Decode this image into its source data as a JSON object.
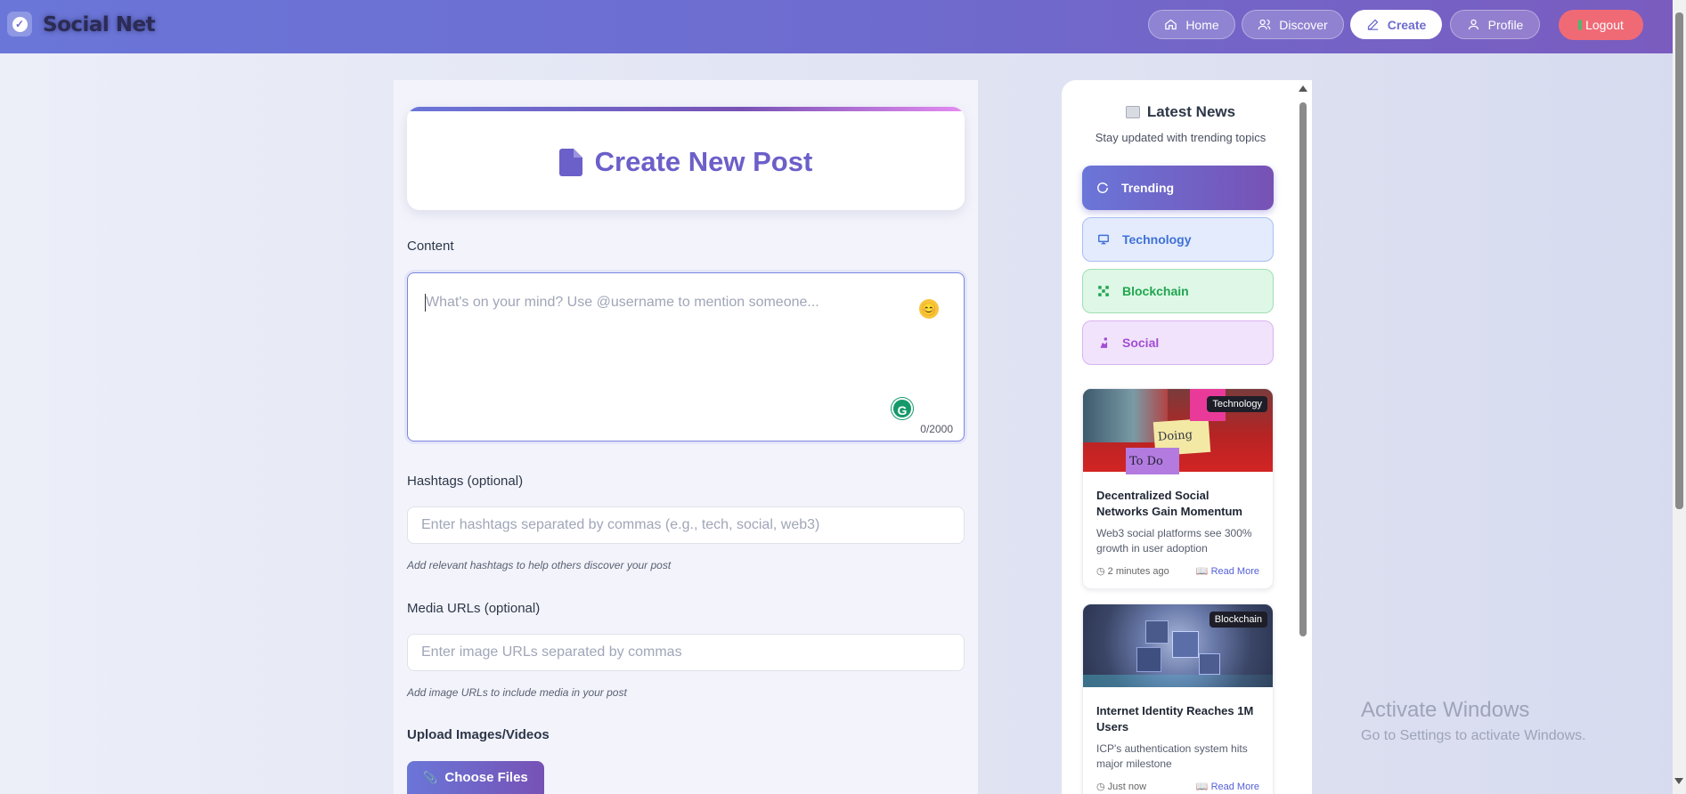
{
  "app": {
    "brand": "Social Net"
  },
  "nav": {
    "home": "Home",
    "discover": "Discover",
    "create": "Create",
    "profile": "Profile",
    "logout": "Logout"
  },
  "form": {
    "title": "Create New Post",
    "content_label": "Content",
    "content_placeholder": "What's on your mind? Use @username to mention someone...",
    "content_value": "",
    "char_counter": "0/2000",
    "hashtags_label": "Hashtags (optional)",
    "hashtags_placeholder": "Enter hashtags separated by commas (e.g., tech, social, web3)",
    "hashtags_hint": "Add relevant hashtags to help others discover your post",
    "media_label": "Media URLs (optional)",
    "media_placeholder": "Enter image URLs separated by commas",
    "media_hint": "Add image URLs to include media in your post",
    "upload_label": "Upload Images/Videos",
    "choose_files": "Choose Files"
  },
  "news": {
    "title": "Latest News",
    "subtitle": "Stay updated with trending topics",
    "categories": [
      {
        "label": "Trending",
        "icon": "refresh-icon"
      },
      {
        "label": "Technology",
        "icon": "monitor-icon"
      },
      {
        "label": "Blockchain",
        "icon": "blocks-icon"
      },
      {
        "label": "Social",
        "icon": "people-icon"
      }
    ],
    "articles": [
      {
        "tag": "Technology",
        "headline": "Decentralized Social Networks Gain Momentum",
        "summary": "Web3 social platforms see 300% growth in user adoption",
        "time": "2 minutes ago",
        "read_more": "Read More"
      },
      {
        "tag": "Blockchain",
        "headline": "Internet Identity Reaches 1M Users",
        "summary": "ICP's authentication system hits major milestone",
        "time": "Just now",
        "read_more": "Read More"
      }
    ]
  },
  "system": {
    "watermark_title": "Activate Windows",
    "watermark_sub": "Go to Settings to activate Windows."
  },
  "colors": {
    "primary": "#6a76d8",
    "accent": "#7752b5",
    "logout": "#f06a76"
  }
}
